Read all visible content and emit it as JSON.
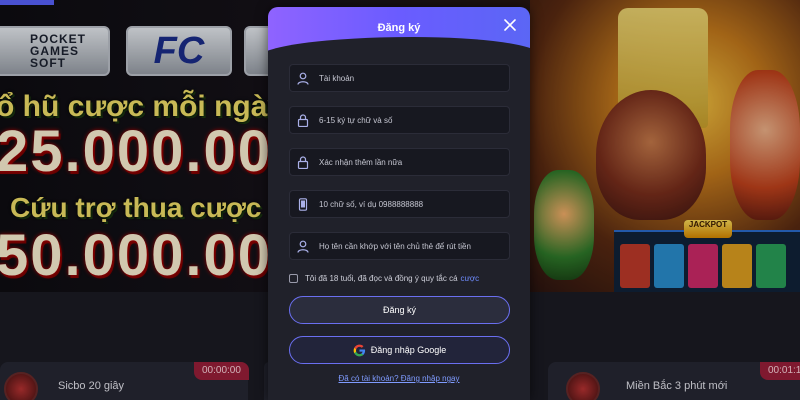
{
  "background": {
    "logos": {
      "provider_1": "POCKET\nGAMES\nSOFT",
      "provider_2": "FC"
    },
    "promo": {
      "line1": "ổ hũ cược mỗi ngày",
      "line2": "25.000.00",
      "line3": "Cứu trợ thua cược",
      "line4": "50.000.00"
    },
    "jackpot_label": "JACKPOT"
  },
  "cards": [
    {
      "title": "Sicbo 20 giây",
      "timer": "00:00:00"
    },
    {
      "title": "Miền Bắc 3 phút mới",
      "timer": "00:01:1"
    }
  ],
  "modal": {
    "title": "Đăng ký",
    "fields": {
      "account_placeholder": "Tài khoản",
      "password_placeholder": "6-15 ký tự chữ và số",
      "confirm_placeholder": "Xác nhận thêm lần nữa",
      "phone_placeholder": "10 chữ số, ví dụ 0988888888",
      "fullname_placeholder": "Họ tên cần khớp với tên chủ thẻ để rút tiền"
    },
    "terms_text": "Tôi đã 18 tuổi, đã đọc và đồng ý quy tắc cá",
    "terms_link": "cược",
    "register_button": "Đăng ký",
    "google_button": "Đăng nhập Google",
    "login_link": "Đã có tài khoản? Đăng nhập ngay"
  },
  "colors": {
    "accent": "#6a5cff",
    "link": "#7f9bff",
    "timer": "#9c1f3a"
  }
}
